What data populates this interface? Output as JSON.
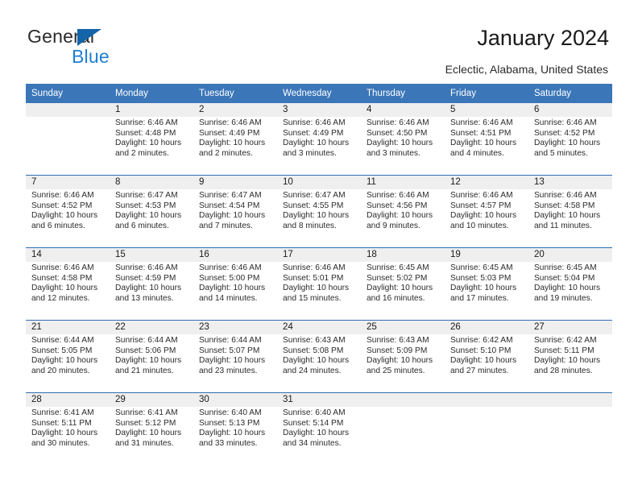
{
  "brand": {
    "name_part1": "General",
    "name_part2": "Blue",
    "triangle_icon": "triangle-icon",
    "accent_dark": "#2b2b2b",
    "accent_blue": "#1f7fd4",
    "triangle_color": "#1464aa"
  },
  "header": {
    "title": "January 2024",
    "subtitle": "Eclectic, Alabama, United States",
    "header_bg": "#3b76b8",
    "row_divider": "#2f6fb0",
    "daynum_bg": "#efefef"
  },
  "weekdays": [
    "Sunday",
    "Monday",
    "Tuesday",
    "Wednesday",
    "Thursday",
    "Friday",
    "Saturday"
  ],
  "weeks": [
    [
      {
        "day": "",
        "sunrise": "",
        "sunset": "",
        "daylight_line1": "",
        "daylight_line2": ""
      },
      {
        "day": "1",
        "sunrise": "Sunrise: 6:46 AM",
        "sunset": "Sunset: 4:48 PM",
        "daylight_line1": "Daylight: 10 hours",
        "daylight_line2": "and 2 minutes."
      },
      {
        "day": "2",
        "sunrise": "Sunrise: 6:46 AM",
        "sunset": "Sunset: 4:49 PM",
        "daylight_line1": "Daylight: 10 hours",
        "daylight_line2": "and 2 minutes."
      },
      {
        "day": "3",
        "sunrise": "Sunrise: 6:46 AM",
        "sunset": "Sunset: 4:49 PM",
        "daylight_line1": "Daylight: 10 hours",
        "daylight_line2": "and 3 minutes."
      },
      {
        "day": "4",
        "sunrise": "Sunrise: 6:46 AM",
        "sunset": "Sunset: 4:50 PM",
        "daylight_line1": "Daylight: 10 hours",
        "daylight_line2": "and 3 minutes."
      },
      {
        "day": "5",
        "sunrise": "Sunrise: 6:46 AM",
        "sunset": "Sunset: 4:51 PM",
        "daylight_line1": "Daylight: 10 hours",
        "daylight_line2": "and 4 minutes."
      },
      {
        "day": "6",
        "sunrise": "Sunrise: 6:46 AM",
        "sunset": "Sunset: 4:52 PM",
        "daylight_line1": "Daylight: 10 hours",
        "daylight_line2": "and 5 minutes."
      }
    ],
    [
      {
        "day": "7",
        "sunrise": "Sunrise: 6:46 AM",
        "sunset": "Sunset: 4:52 PM",
        "daylight_line1": "Daylight: 10 hours",
        "daylight_line2": "and 6 minutes."
      },
      {
        "day": "8",
        "sunrise": "Sunrise: 6:47 AM",
        "sunset": "Sunset: 4:53 PM",
        "daylight_line1": "Daylight: 10 hours",
        "daylight_line2": "and 6 minutes."
      },
      {
        "day": "9",
        "sunrise": "Sunrise: 6:47 AM",
        "sunset": "Sunset: 4:54 PM",
        "daylight_line1": "Daylight: 10 hours",
        "daylight_line2": "and 7 minutes."
      },
      {
        "day": "10",
        "sunrise": "Sunrise: 6:47 AM",
        "sunset": "Sunset: 4:55 PM",
        "daylight_line1": "Daylight: 10 hours",
        "daylight_line2": "and 8 minutes."
      },
      {
        "day": "11",
        "sunrise": "Sunrise: 6:46 AM",
        "sunset": "Sunset: 4:56 PM",
        "daylight_line1": "Daylight: 10 hours",
        "daylight_line2": "and 9 minutes."
      },
      {
        "day": "12",
        "sunrise": "Sunrise: 6:46 AM",
        "sunset": "Sunset: 4:57 PM",
        "daylight_line1": "Daylight: 10 hours",
        "daylight_line2": "and 10 minutes."
      },
      {
        "day": "13",
        "sunrise": "Sunrise: 6:46 AM",
        "sunset": "Sunset: 4:58 PM",
        "daylight_line1": "Daylight: 10 hours",
        "daylight_line2": "and 11 minutes."
      }
    ],
    [
      {
        "day": "14",
        "sunrise": "Sunrise: 6:46 AM",
        "sunset": "Sunset: 4:58 PM",
        "daylight_line1": "Daylight: 10 hours",
        "daylight_line2": "and 12 minutes."
      },
      {
        "day": "15",
        "sunrise": "Sunrise: 6:46 AM",
        "sunset": "Sunset: 4:59 PM",
        "daylight_line1": "Daylight: 10 hours",
        "daylight_line2": "and 13 minutes."
      },
      {
        "day": "16",
        "sunrise": "Sunrise: 6:46 AM",
        "sunset": "Sunset: 5:00 PM",
        "daylight_line1": "Daylight: 10 hours",
        "daylight_line2": "and 14 minutes."
      },
      {
        "day": "17",
        "sunrise": "Sunrise: 6:46 AM",
        "sunset": "Sunset: 5:01 PM",
        "daylight_line1": "Daylight: 10 hours",
        "daylight_line2": "and 15 minutes."
      },
      {
        "day": "18",
        "sunrise": "Sunrise: 6:45 AM",
        "sunset": "Sunset: 5:02 PM",
        "daylight_line1": "Daylight: 10 hours",
        "daylight_line2": "and 16 minutes."
      },
      {
        "day": "19",
        "sunrise": "Sunrise: 6:45 AM",
        "sunset": "Sunset: 5:03 PM",
        "daylight_line1": "Daylight: 10 hours",
        "daylight_line2": "and 17 minutes."
      },
      {
        "day": "20",
        "sunrise": "Sunrise: 6:45 AM",
        "sunset": "Sunset: 5:04 PM",
        "daylight_line1": "Daylight: 10 hours",
        "daylight_line2": "and 19 minutes."
      }
    ],
    [
      {
        "day": "21",
        "sunrise": "Sunrise: 6:44 AM",
        "sunset": "Sunset: 5:05 PM",
        "daylight_line1": "Daylight: 10 hours",
        "daylight_line2": "and 20 minutes."
      },
      {
        "day": "22",
        "sunrise": "Sunrise: 6:44 AM",
        "sunset": "Sunset: 5:06 PM",
        "daylight_line1": "Daylight: 10 hours",
        "daylight_line2": "and 21 minutes."
      },
      {
        "day": "23",
        "sunrise": "Sunrise: 6:44 AM",
        "sunset": "Sunset: 5:07 PM",
        "daylight_line1": "Daylight: 10 hours",
        "daylight_line2": "and 23 minutes."
      },
      {
        "day": "24",
        "sunrise": "Sunrise: 6:43 AM",
        "sunset": "Sunset: 5:08 PM",
        "daylight_line1": "Daylight: 10 hours",
        "daylight_line2": "and 24 minutes."
      },
      {
        "day": "25",
        "sunrise": "Sunrise: 6:43 AM",
        "sunset": "Sunset: 5:09 PM",
        "daylight_line1": "Daylight: 10 hours",
        "daylight_line2": "and 25 minutes."
      },
      {
        "day": "26",
        "sunrise": "Sunrise: 6:42 AM",
        "sunset": "Sunset: 5:10 PM",
        "daylight_line1": "Daylight: 10 hours",
        "daylight_line2": "and 27 minutes."
      },
      {
        "day": "27",
        "sunrise": "Sunrise: 6:42 AM",
        "sunset": "Sunset: 5:11 PM",
        "daylight_line1": "Daylight: 10 hours",
        "daylight_line2": "and 28 minutes."
      }
    ],
    [
      {
        "day": "28",
        "sunrise": "Sunrise: 6:41 AM",
        "sunset": "Sunset: 5:11 PM",
        "daylight_line1": "Daylight: 10 hours",
        "daylight_line2": "and 30 minutes."
      },
      {
        "day": "29",
        "sunrise": "Sunrise: 6:41 AM",
        "sunset": "Sunset: 5:12 PM",
        "daylight_line1": "Daylight: 10 hours",
        "daylight_line2": "and 31 minutes."
      },
      {
        "day": "30",
        "sunrise": "Sunrise: 6:40 AM",
        "sunset": "Sunset: 5:13 PM",
        "daylight_line1": "Daylight: 10 hours",
        "daylight_line2": "and 33 minutes."
      },
      {
        "day": "31",
        "sunrise": "Sunrise: 6:40 AM",
        "sunset": "Sunset: 5:14 PM",
        "daylight_line1": "Daylight: 10 hours",
        "daylight_line2": "and 34 minutes."
      },
      {
        "day": "",
        "sunrise": "",
        "sunset": "",
        "daylight_line1": "",
        "daylight_line2": ""
      },
      {
        "day": "",
        "sunrise": "",
        "sunset": "",
        "daylight_line1": "",
        "daylight_line2": ""
      },
      {
        "day": "",
        "sunrise": "",
        "sunset": "",
        "daylight_line1": "",
        "daylight_line2": ""
      }
    ]
  ]
}
